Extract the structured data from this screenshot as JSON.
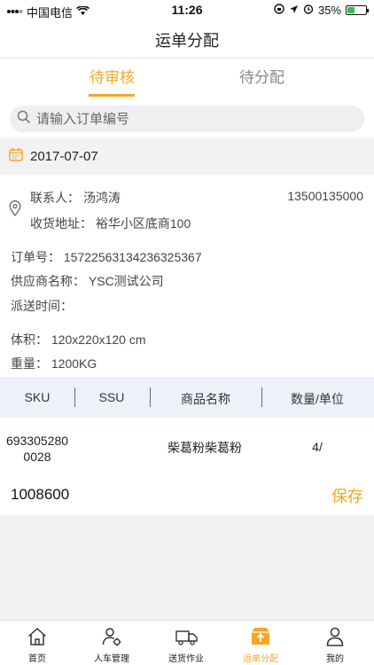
{
  "status_bar": {
    "carrier": "中国电信",
    "time": "11:26",
    "battery": "35%"
  },
  "nav": {
    "title": "运单分配"
  },
  "tabs": [
    {
      "label": "待审核",
      "active": true
    },
    {
      "label": "待分配",
      "active": false
    }
  ],
  "search": {
    "placeholder": "请输入订单编号",
    "value": ""
  },
  "order": {
    "date": "2017-07-07",
    "contact_label": "联系人：",
    "contact_name": "汤鸿涛",
    "phone": "13500135000",
    "address_label": "收货地址：",
    "address": "裕华小区底商100",
    "order_no_label": "订单号：",
    "order_no": "15722563134236325367",
    "supplier_label": "供应商名称：",
    "supplier": "YSC测试公司",
    "delivery_time_label": "派送时间：",
    "delivery_time": "",
    "volume_label": "体积：",
    "volume": "120x220x120 cm",
    "weight_label": "重量：",
    "weight": "1200KG"
  },
  "table": {
    "headers": [
      "SKU",
      "SSU",
      "商品名称",
      "数量/单位"
    ],
    "rows": [
      {
        "sku_line1": "693305280",
        "sku_line2": "0028",
        "ssu": "",
        "name": "柴葛粉柴葛粉",
        "qty": "4/"
      }
    ]
  },
  "footer": {
    "id": "1008600",
    "save_label": "保存"
  },
  "tab_bar": [
    {
      "label": "首页",
      "icon": "home-icon",
      "active": false
    },
    {
      "label": "人车管理",
      "icon": "person-gear-icon",
      "active": false
    },
    {
      "label": "送货作业",
      "icon": "truck-icon",
      "active": false
    },
    {
      "label": "运单分配",
      "icon": "box-upload-icon",
      "active": true
    },
    {
      "label": "我的",
      "icon": "user-icon",
      "active": false
    }
  ],
  "colors": {
    "accent": "#f5a623",
    "table_header_bg": "#eef2f8",
    "page_bg": "#f2f2f4"
  }
}
